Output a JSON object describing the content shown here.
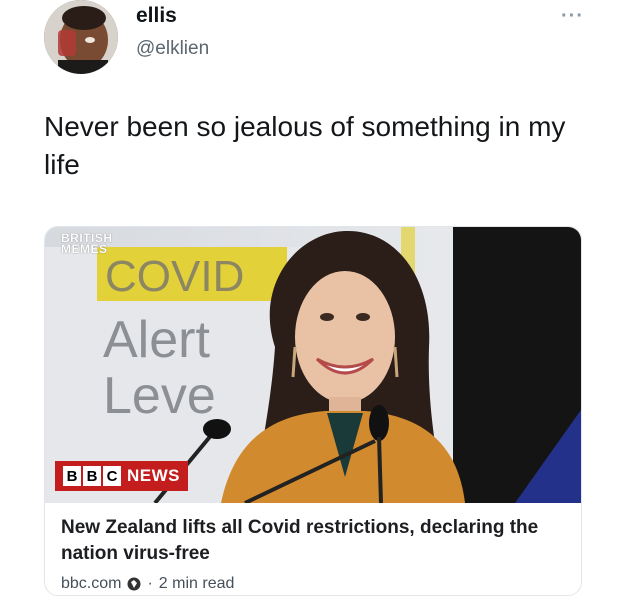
{
  "user": {
    "name": "ellis",
    "handle": "@elklien"
  },
  "menu": {
    "more_label": "···"
  },
  "tweet": {
    "text": "Never been so jealous of something in my life"
  },
  "card": {
    "watermark_line1": "BRITISH",
    "watermark_line2": "MEMES",
    "image_sign_word1": "COVID",
    "image_sign_word2": "Alert",
    "image_sign_word3": "Leve",
    "badge_letters": [
      "B",
      "B",
      "C"
    ],
    "badge_news": "NEWS",
    "title": "New Zealand lifts all Covid restrictions, declaring the nation virus-free",
    "domain": "bbc.com",
    "separator": "·",
    "read_time": "2 min read"
  },
  "colors": {
    "bbc_red": "#c41d1d",
    "sign_yellow": "#e3d13a",
    "jacket": "#d28a2e"
  }
}
